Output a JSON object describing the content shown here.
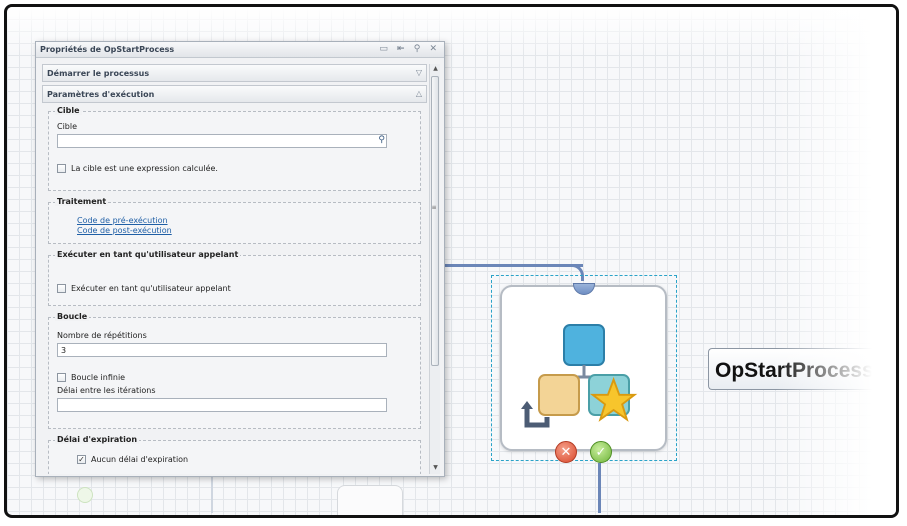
{
  "panel": {
    "title": "Propriétés de OpStartProcess",
    "title_buttons": "▭ ⇤ ⚲ ✕",
    "sections": [
      {
        "label": "Démarrer le processus",
        "chevron": "▽"
      },
      {
        "label": "Paramètres d'exécution",
        "chevron": "△"
      }
    ],
    "cible": {
      "legend": "Cible",
      "field_label": "Cible",
      "value": "",
      "computed_label": "La cible est une expression calculée.",
      "computed_checked": false
    },
    "traitement": {
      "legend": "Traitement",
      "pre_link": "Code de pré-exécution",
      "post_link": "Code de post-exécution"
    },
    "execute_as": {
      "legend": "Exécuter en tant qu'utilisateur appelant",
      "checkbox_label": "Exécuter en tant qu'utilisateur appelant",
      "checked": false
    },
    "boucle": {
      "legend": "Boucle",
      "repeat_label": "Nombre de répétitions",
      "repeat_value": "3",
      "infinite_label": "Boucle infinie",
      "infinite_checked": false,
      "delay_label": "Délai entre les itérations",
      "delay_value": ""
    },
    "timeout": {
      "legend": "Délai d'expiration",
      "none_label": "Aucun délai d'expiration",
      "none_checked": true
    }
  },
  "canvas": {
    "node_label": "OpStartProcess",
    "error_glyph": "✕",
    "ok_glyph": "✓",
    "colors": {
      "connector": "#6b86b8",
      "selection": "#2aa3c8",
      "link": "#1f5fa6"
    }
  }
}
